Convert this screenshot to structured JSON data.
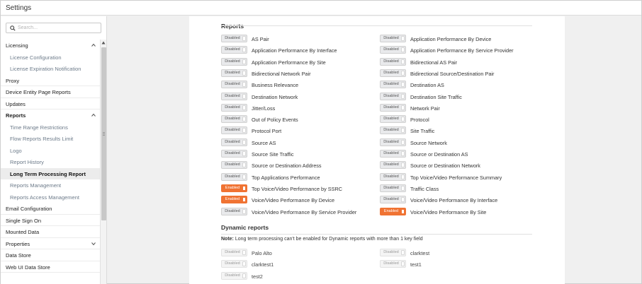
{
  "window": {
    "title": "Settings"
  },
  "search": {
    "placeholder": "Search..."
  },
  "sidebar": {
    "items": [
      {
        "label": "Licensing",
        "kind": "group",
        "chevron": "up"
      },
      {
        "label": "License Configuration",
        "kind": "sub"
      },
      {
        "label": "License Expiration Notification",
        "kind": "sub"
      },
      {
        "label": "Proxy",
        "kind": "top"
      },
      {
        "label": "Device Entity Page Reports",
        "kind": "top"
      },
      {
        "label": "Updates",
        "kind": "top"
      },
      {
        "label": "Reports",
        "kind": "group-bold",
        "chevron": "up"
      },
      {
        "label": "Time Range Restrictions",
        "kind": "sub"
      },
      {
        "label": "Flow Reports Results Limit",
        "kind": "sub"
      },
      {
        "label": "Logo",
        "kind": "sub"
      },
      {
        "label": "Report History",
        "kind": "sub"
      },
      {
        "label": "Long Term Processing Report",
        "kind": "sub-active"
      },
      {
        "label": "Reports Management",
        "kind": "sub"
      },
      {
        "label": "Reports Access Management",
        "kind": "sub"
      },
      {
        "label": "Email Configuration",
        "kind": "top"
      },
      {
        "label": "Single Sign On",
        "kind": "top"
      },
      {
        "label": "Mounted Data",
        "kind": "top"
      },
      {
        "label": "Properties",
        "kind": "top",
        "chevron": "down"
      },
      {
        "label": "Data Store",
        "kind": "top"
      },
      {
        "label": "Web UI Data Store",
        "kind": "top"
      }
    ]
  },
  "reports": {
    "title": "Reports",
    "left": [
      {
        "label": "AS Pair",
        "state": "Disabled"
      },
      {
        "label": "Application Performance By Interface",
        "state": "Disabled"
      },
      {
        "label": "Application Performance By Site",
        "state": "Disabled"
      },
      {
        "label": "Bidirectional Network Pair",
        "state": "Disabled"
      },
      {
        "label": "Business Relevance",
        "state": "Disabled"
      },
      {
        "label": "Destination Network",
        "state": "Disabled"
      },
      {
        "label": "Jitter/Loss",
        "state": "Disabled"
      },
      {
        "label": "Out of Policy Events",
        "state": "Disabled"
      },
      {
        "label": "Protocol Port",
        "state": "Disabled"
      },
      {
        "label": "Source AS",
        "state": "Disabled"
      },
      {
        "label": "Source Site Traffic",
        "state": "Disabled"
      },
      {
        "label": "Source or Destination Address",
        "state": "Disabled"
      },
      {
        "label": "Top Applications Performance",
        "state": "Disabled"
      },
      {
        "label": "Top Voice/Video Performance by SSRC",
        "state": "Enabled"
      },
      {
        "label": "Voice/Video Performance By Device",
        "state": "Enabled"
      },
      {
        "label": "Voice/Video Performance By Service Provider",
        "state": "Disabled"
      }
    ],
    "right": [
      {
        "label": "Application Performance By Device",
        "state": "Disabled"
      },
      {
        "label": "Application Performance By Service Provider",
        "state": "Disabled"
      },
      {
        "label": "Bidirectional AS Pair",
        "state": "Disabled"
      },
      {
        "label": "Bidirectional Source/Destination Pair",
        "state": "Disabled"
      },
      {
        "label": "Destination AS",
        "state": "Disabled"
      },
      {
        "label": "Destination Site Traffic",
        "state": "Disabled"
      },
      {
        "label": "Network Pair",
        "state": "Disabled"
      },
      {
        "label": "Protocol",
        "state": "Disabled"
      },
      {
        "label": "Site Traffic",
        "state": "Disabled"
      },
      {
        "label": "Source Network",
        "state": "Disabled"
      },
      {
        "label": "Source or Destination AS",
        "state": "Disabled"
      },
      {
        "label": "Source or Destination Network",
        "state": "Disabled"
      },
      {
        "label": "Top Voice/Video Performance Summary",
        "state": "Disabled"
      },
      {
        "label": "Traffic Class",
        "state": "Disabled"
      },
      {
        "label": "Voice/Video Performance By Interface",
        "state": "Disabled"
      },
      {
        "label": "Voice/Video Performance By Site",
        "state": "Enabled"
      }
    ]
  },
  "dynamic": {
    "title": "Dynamic reports",
    "note_label": "Note:",
    "note_text": " Long term processing can't be enabled for Dynamic reports with more than 1 key field",
    "left": [
      {
        "label": "Palo Alto",
        "state": "Disabled"
      },
      {
        "label": "clarktest1",
        "state": "Disabled"
      },
      {
        "label": "test2",
        "state": "Disabled"
      }
    ],
    "right": [
      {
        "label": "clarktest",
        "state": "Disabled"
      },
      {
        "label": "test1",
        "state": "Disabled"
      }
    ]
  },
  "colors": {
    "enabled": "#f07333",
    "disabled": "#e9eaec"
  }
}
